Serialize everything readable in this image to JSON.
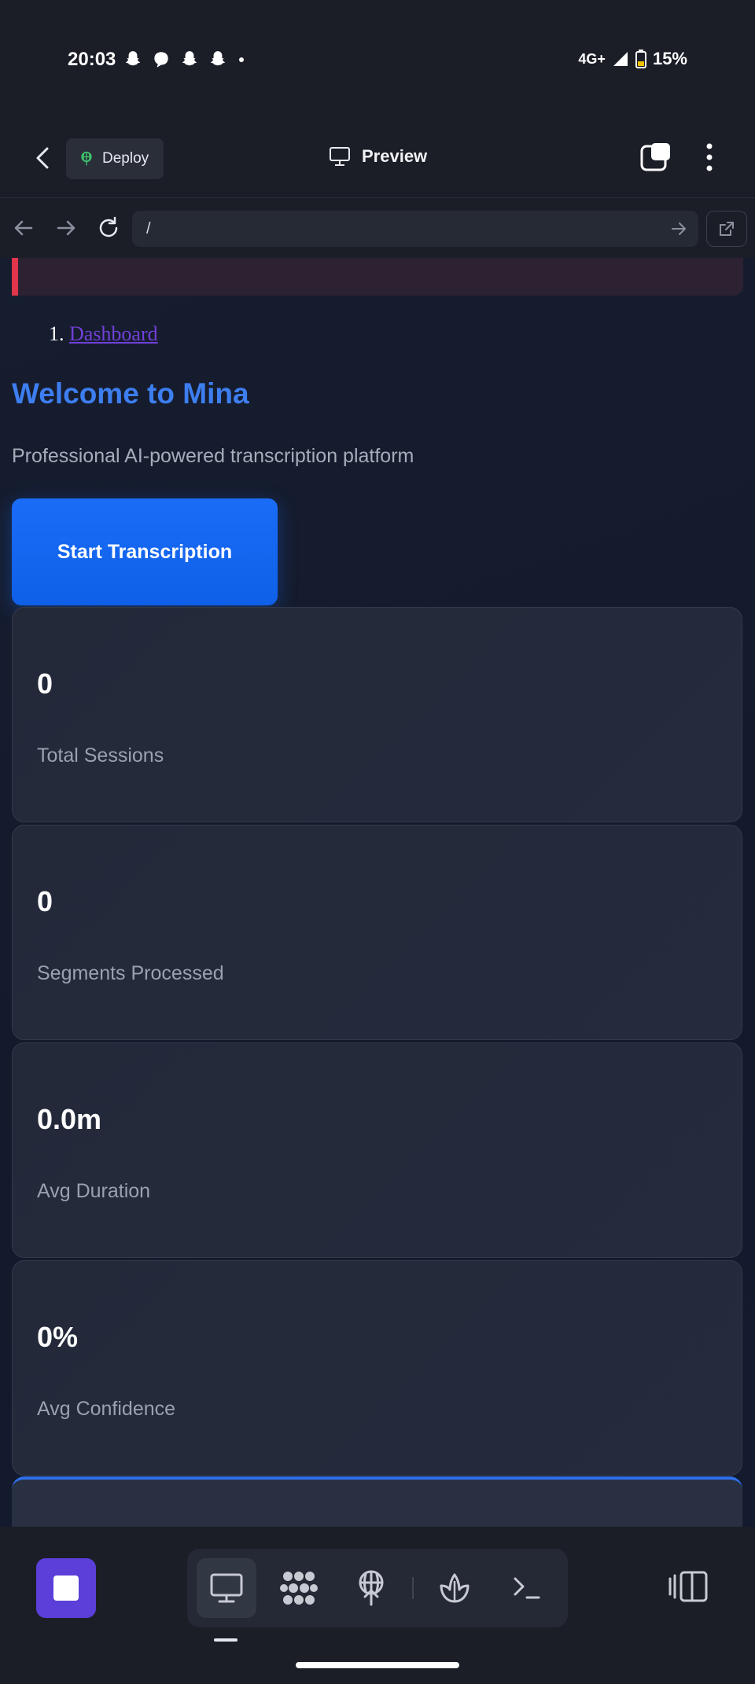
{
  "status_bar": {
    "time": "20:03",
    "network": "4G+",
    "battery": "15%"
  },
  "app_bar": {
    "deploy_label": "Deploy",
    "title": "Preview"
  },
  "browser_bar": {
    "url": "/"
  },
  "page": {
    "breadcrumb_number": "1.",
    "breadcrumb_link": "Dashboard",
    "heading": "Welcome to Mina",
    "subtitle": "Professional AI-powered transcription platform",
    "start_button": "Start Transcription",
    "stats": [
      {
        "value": "0",
        "label": "Total Sessions"
      },
      {
        "value": "0",
        "label": "Segments Processed"
      },
      {
        "value": "0.0m",
        "label": "Avg Duration"
      },
      {
        "value": "0%",
        "label": "Avg Confidence"
      }
    ]
  },
  "colors": {
    "accent_blue": "#1a6cf7",
    "heading_blue": "#3d7ef0",
    "alert_red": "#e0354a",
    "stop_purple": "#5b3fd8",
    "link_purple": "#7140d8"
  },
  "bottom_toolbar": {
    "icons": [
      "stop-icon",
      "desktop-icon",
      "apps-icon",
      "deploy-icon",
      "shell-icon",
      "terminal-icon",
      "panel-toggle-icon"
    ]
  }
}
